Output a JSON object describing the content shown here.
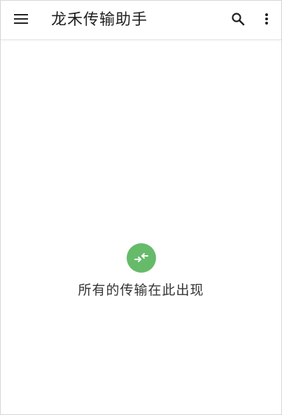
{
  "app_bar": {
    "title": "龙禾传输助手",
    "menu_icon": "hamburger-menu-icon",
    "search_icon": "search-icon",
    "more_icon": "more-vertical-icon"
  },
  "empty_state": {
    "icon": "transfer-arrows-icon",
    "icon_color": "#66bb6a",
    "message": "所有的传输在此出现"
  }
}
